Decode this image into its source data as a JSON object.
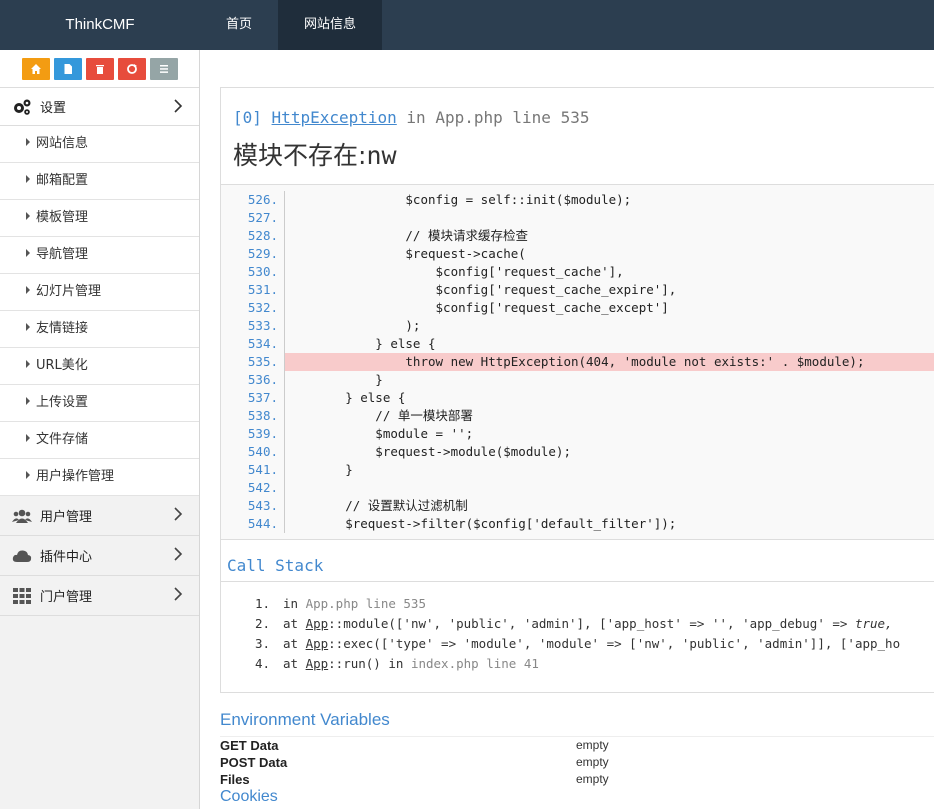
{
  "brand": "ThinkCMF",
  "topnav": [
    {
      "label": "首页",
      "active": false
    },
    {
      "label": "网站信息",
      "active": true
    }
  ],
  "shortcuts": [
    {
      "icon": "home-icon",
      "color": "#f39c12"
    },
    {
      "icon": "file-icon",
      "color": "#3498db"
    },
    {
      "icon": "trash-icon",
      "color": "#e74c3c"
    },
    {
      "icon": "recycle-icon",
      "color": "#e74c3c"
    },
    {
      "icon": "list-icon",
      "color": "#95a5a6"
    }
  ],
  "sidebar": {
    "settings": {
      "label": "设置",
      "icon": "gears-icon"
    },
    "sub_items": [
      "网站信息",
      "邮箱配置",
      "模板管理",
      "导航管理",
      "幻灯片管理",
      "友情链接",
      "URL美化",
      "上传设置",
      "文件存储",
      "用户操作管理"
    ],
    "groups": [
      {
        "label": "用户管理",
        "icon": "users-icon"
      },
      {
        "label": "插件中心",
        "icon": "cloud-icon"
      },
      {
        "label": "门户管理",
        "icon": "grid-icon"
      }
    ]
  },
  "exception": {
    "index": "[0]",
    "class": "HttpException",
    "in_text": "in",
    "file": "App.php",
    "line_label": "line 535",
    "message_cn": "模块不存在:",
    "message_mono": "nw"
  },
  "source": [
    {
      "ln": "526.",
      "code": "                $config = self::init($module);"
    },
    {
      "ln": "527.",
      "code": ""
    },
    {
      "ln": "528.",
      "code": "                // 模块请求缓存检查"
    },
    {
      "ln": "529.",
      "code": "                $request->cache("
    },
    {
      "ln": "530.",
      "code": "                    $config['request_cache'],"
    },
    {
      "ln": "531.",
      "code": "                    $config['request_cache_expire'],"
    },
    {
      "ln": "532.",
      "code": "                    $config['request_cache_except']"
    },
    {
      "ln": "533.",
      "code": "                );"
    },
    {
      "ln": "534.",
      "code": "            } else {"
    },
    {
      "ln": "535.",
      "code": "                throw new HttpException(404, 'module not exists:' . $module);",
      "highlight": true
    },
    {
      "ln": "536.",
      "code": "            }"
    },
    {
      "ln": "537.",
      "code": "        } else {"
    },
    {
      "ln": "538.",
      "code": "            // 单一模块部署"
    },
    {
      "ln": "539.",
      "code": "            $module = '';"
    },
    {
      "ln": "540.",
      "code": "            $request->module($module);"
    },
    {
      "ln": "541.",
      "code": "        }"
    },
    {
      "ln": "542.",
      "code": ""
    },
    {
      "ln": "543.",
      "code": "        // 设置默认过滤机制"
    },
    {
      "ln": "544.",
      "code": "        $request->filter($config['default_filter']);"
    }
  ],
  "callstack_title": "Call Stack",
  "callstack": [
    {
      "n": "1.",
      "pre": "in ",
      "link": "",
      "rest": "",
      "fn": "App.php line 535"
    },
    {
      "n": "2.",
      "pre": "at ",
      "link": "App",
      "rest": "::module(['nw', 'public', 'admin'], ['app_host' => '', 'app_debug' => ",
      "italic": "true,"
    },
    {
      "n": "3.",
      "pre": "at ",
      "link": "App",
      "rest": "::exec(['type' => 'module', 'module' => ['nw', 'public', 'admin']], ['app_ho"
    },
    {
      "n": "4.",
      "pre": "at ",
      "link": "App",
      "rest": "::run() in ",
      "fn": "index.php line 41"
    }
  ],
  "env": {
    "title": "Environment Variables",
    "rows": [
      {
        "key": "GET Data",
        "value": "empty"
      },
      {
        "key": "POST Data",
        "value": "empty"
      },
      {
        "key": "Files",
        "value": "empty"
      }
    ],
    "cookies": "Cookies"
  }
}
